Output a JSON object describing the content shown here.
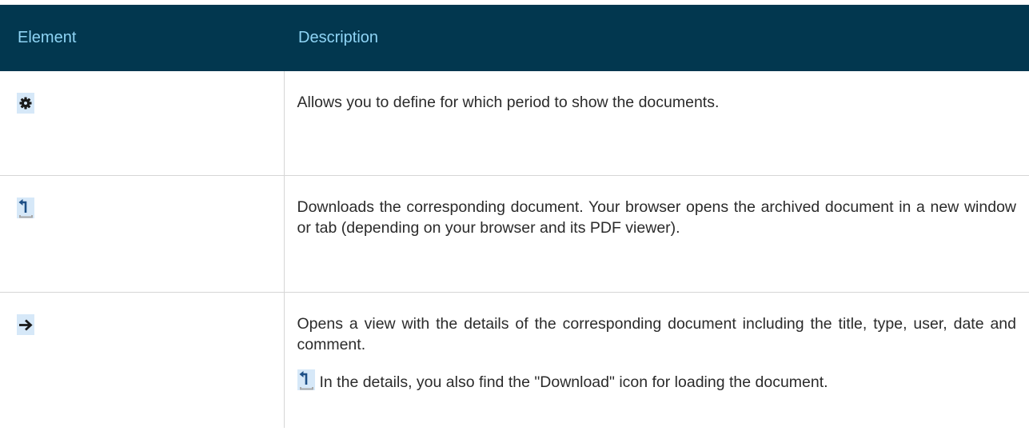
{
  "table": {
    "headers": {
      "element": "Element",
      "description": "Description"
    },
    "rows": [
      {
        "icon": "gear-icon",
        "description": "Allows you to define for which period to show the documents."
      },
      {
        "icon": "download-icon",
        "description": "Downloads the corresponding document. Your browser opens the archived document in a new window or tab (depending on your browser and its PDF viewer)."
      },
      {
        "icon": "arrow-right-icon",
        "description": "Opens a view with the details of the corresponding document including the title, type, user, date and comment.",
        "note": "In the details, you also find the \"Download\" icon for loading the document.",
        "note_icon": "download-icon"
      }
    ]
  },
  "colors": {
    "header_bg": "#02374f",
    "header_text": "#8fd4f5",
    "icon_bg": "#d6e8f8",
    "icon_fg": "#1a1a1a",
    "download_fg": "#1d4f86",
    "tray": "#a8a8a8",
    "border": "#d6d6d6"
  }
}
